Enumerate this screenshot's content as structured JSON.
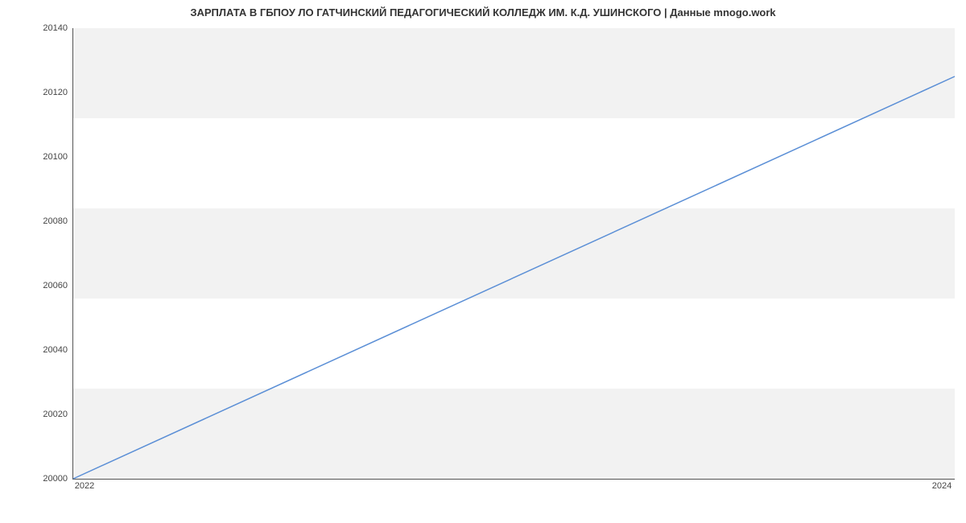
{
  "chart_data": {
    "type": "line",
    "title": "ЗАРПЛАТА В ГБПОУ ЛО ГАТЧИНСКИЙ ПЕДАГОГИЧЕСКИЙ КОЛЛЕДЖ ИМ. К.Д. УШИНСКОГО | Данные mnogo.work",
    "xlabel": "",
    "ylabel": "",
    "x": [
      2022,
      2024
    ],
    "values": [
      20000,
      20125
    ],
    "xlim": [
      2022,
      2024
    ],
    "ylim": [
      20000,
      20140
    ],
    "y_ticks": [
      20000,
      20020,
      20040,
      20060,
      20080,
      20100,
      20120,
      20140
    ],
    "x_ticks": [
      2022,
      2024
    ],
    "line_color": "#5b8fd6"
  }
}
